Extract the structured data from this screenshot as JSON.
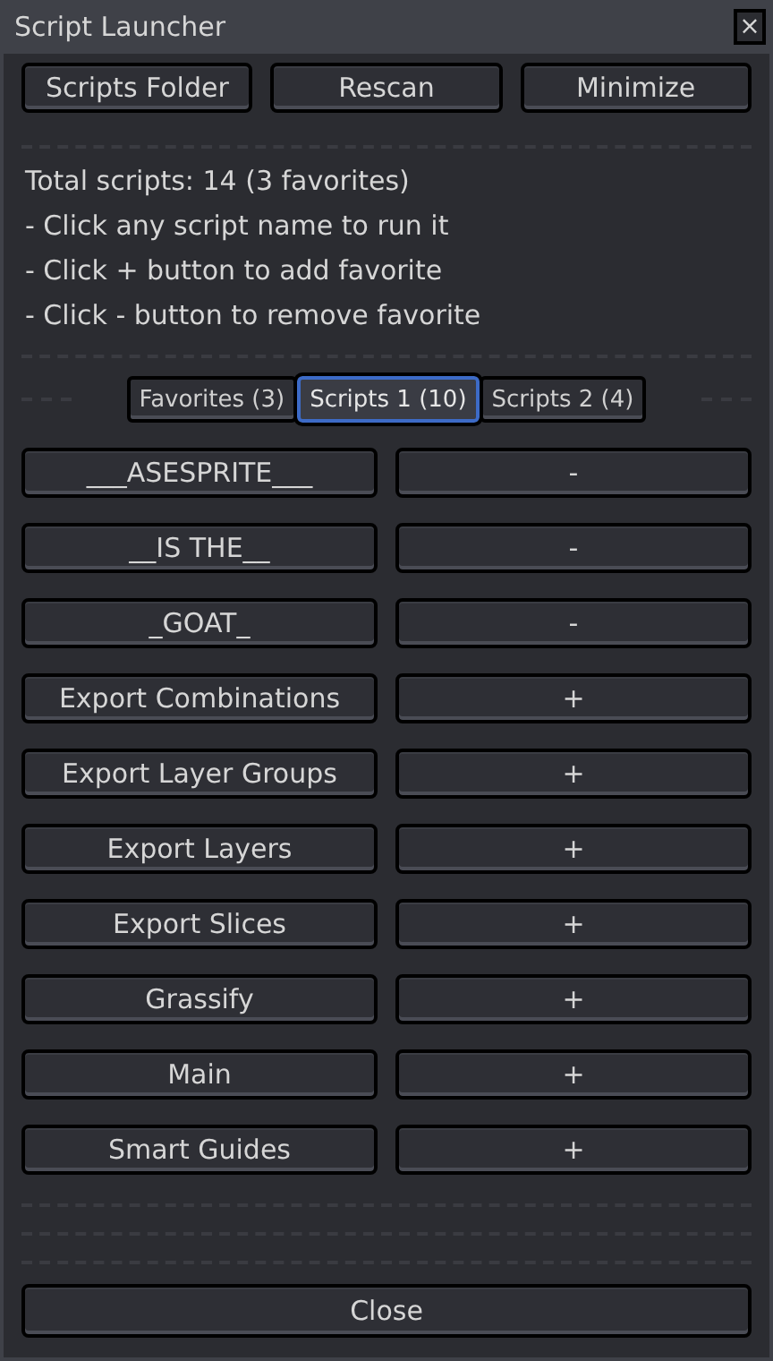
{
  "window": {
    "title": "Script Launcher",
    "close_glyph": "×"
  },
  "top_buttons": [
    "Scripts Folder",
    "Rescan",
    "Minimize"
  ],
  "info_lines": [
    "Total scripts: 14 (3 favorites)",
    "- Click any script name to run it",
    "- Click + button to add favorite",
    "- Click - button to remove favorite"
  ],
  "tabs": [
    {
      "label": "Favorites (3)",
      "selected": false
    },
    {
      "label": "Scripts 1 (10)",
      "selected": true
    },
    {
      "label": "Scripts 2 (4)",
      "selected": false
    }
  ],
  "scripts": [
    {
      "name": "___ASESPRITE___",
      "action": "-"
    },
    {
      "name": "__IS THE__",
      "action": "-"
    },
    {
      "name": "_GOAT_",
      "action": "-"
    },
    {
      "name": "Export Combinations",
      "action": "+"
    },
    {
      "name": "Export Layer Groups",
      "action": "+"
    },
    {
      "name": "Export Layers",
      "action": "+"
    },
    {
      "name": "Export Slices",
      "action": "+"
    },
    {
      "name": "Grassify",
      "action": "+"
    },
    {
      "name": "Main",
      "action": "+"
    },
    {
      "name": "Smart Guides",
      "action": "+"
    }
  ],
  "close_button": "Close"
}
